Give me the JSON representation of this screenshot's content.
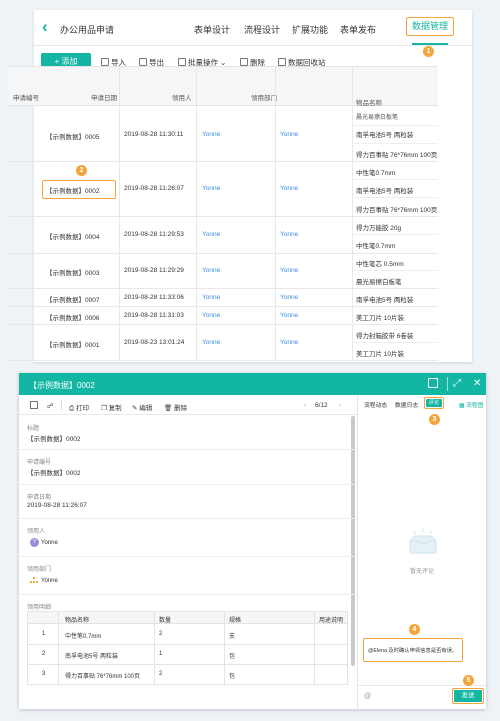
{
  "app": {
    "title": "办公用品申请"
  },
  "nav": [
    {
      "label": "表单设计"
    },
    {
      "label": "流程设计"
    },
    {
      "label": "扩展功能"
    },
    {
      "label": "表单发布"
    },
    {
      "label": "数据管理"
    }
  ],
  "badges": [
    "1",
    "2",
    "3",
    "4",
    "5"
  ],
  "toolbar": {
    "add": "+ 添加",
    "import": "导入",
    "export": "导出",
    "batch": "批量操作",
    "delete": "删除",
    "recycle": "数据回收站"
  },
  "table": {
    "headers": [
      "申请编号",
      "申请日期",
      "领用人",
      "领用部门",
      "物品名称"
    ],
    "top_partial": "晨光易擦白板笔",
    "rows": [
      {
        "id": "【示例数据】0005",
        "date": "2019-08-28 11:30:11",
        "person": "Yonne",
        "dept": "Yonne",
        "items": [
          "南孚电池5号 两粒装",
          "得力百事贴 76*76mm 100页"
        ]
      },
      {
        "id": "【示例数据】0002",
        "date": "2019-08-28 11:26:07",
        "person": "Yonne",
        "dept": "Yonne",
        "items": [
          "中性笔0.7mm",
          "南孚电池5号 两粒装",
          "得力百事贴 76*76mm 100页"
        ]
      },
      {
        "id": "【示例数据】0004",
        "date": "2019-08-28 11:29:53",
        "person": "Yonne",
        "dept": "Yonne",
        "items": [
          "得力万能胶 20g",
          "中性笔0.7mm"
        ]
      },
      {
        "id": "【示例数据】0003",
        "date": "2019-08-28 11:29:29",
        "person": "Yonne",
        "dept": "Yonne",
        "items": [
          "中性笔芯 0.5mm",
          "晨光易擦白板笔"
        ]
      },
      {
        "id": "【示例数据】0007",
        "date": "2019-08-28 11:33:06",
        "person": "Yonne",
        "dept": "Yonne",
        "items": [
          "南孚电池5号 两粒装"
        ]
      },
      {
        "id": "【示例数据】0006",
        "date": "2019-08-28 11:31:03",
        "person": "Yonne",
        "dept": "Yonne",
        "items": [
          "美工刀片 10片装"
        ]
      },
      {
        "id": "【示例数据】0001",
        "date": "2019-08-23 13:01:24",
        "person": "Yonne",
        "dept": "Yonne",
        "items": [
          "得力封箱胶带 6卷装",
          "美工刀片 10片装"
        ]
      }
    ]
  },
  "dialog": {
    "title": "【示例数据】0002",
    "toolbar": {
      "print": "打印",
      "copy": "复制",
      "edit": "编辑",
      "delete": "删除",
      "pager": "6/12"
    },
    "fields": [
      {
        "label": "标题",
        "value": "【示例数据】0002"
      },
      {
        "label": "申请编号",
        "value": "【示例数据】0002"
      },
      {
        "label": "申请日期",
        "value": "2019-08-28 11:26:07"
      },
      {
        "label": "领用人",
        "value": "Yonne"
      },
      {
        "label": "领用部门",
        "value": "Yonne"
      }
    ],
    "avatar_letter": "Y",
    "detail": {
      "label": "领用明细",
      "headers": [
        "物品名称",
        "数量",
        "规格",
        "用途说明"
      ],
      "rows": [
        {
          "n": "1",
          "name": "中性笔0.7mm",
          "qty": "2",
          "spec": "支"
        },
        {
          "n": "2",
          "name": "南孚电池5号 两粒装",
          "qty": "1",
          "spec": "包"
        },
        {
          "n": "3",
          "name": "得力百事贴 76*76mm 100页",
          "qty": "2",
          "spec": "包"
        }
      ]
    },
    "tabs": {
      "flow": "流程动态",
      "log": "数据日志",
      "comment": "评论",
      "chart": "流程图"
    },
    "empty": "暂无评论",
    "comment_text": "@Elena 及时确认申领信息是否有误。",
    "send": "发送"
  },
  "colors": {
    "accent": "#13b5a3",
    "highlight": "#f2a53a",
    "link": "#3a8ee6"
  }
}
